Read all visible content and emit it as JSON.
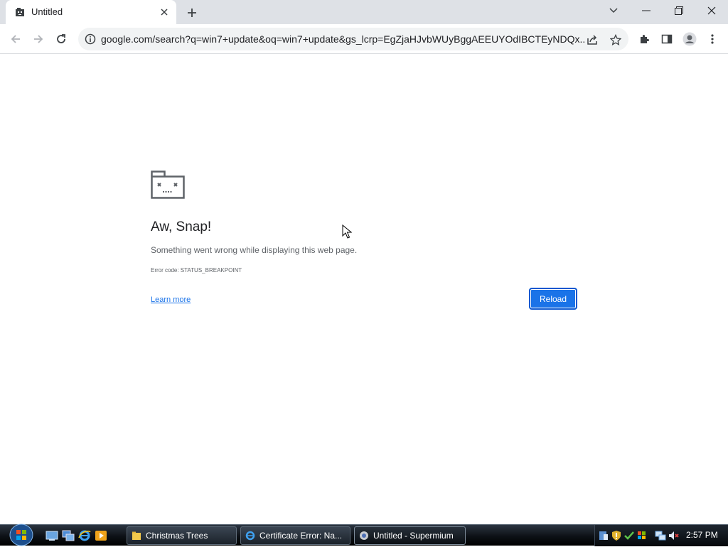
{
  "tab": {
    "title": "Untitled",
    "favicon": "sad-tab-icon"
  },
  "toolbar": {
    "url": "google.com/search?q=win7+update&oq=win7+update&gs_lcrp=EgZjaHJvbWUyBggAEEUYOdIBCTEyNDQx..."
  },
  "error_page": {
    "title": "Aw, Snap!",
    "message": "Something went wrong while displaying this web page.",
    "error_code": "Error code: STATUS_BREAKPOINT",
    "learn_more": "Learn more",
    "reload": "Reload"
  },
  "taskbar": {
    "tasks": [
      {
        "label": "Christmas Trees",
        "icon": "folder-icon"
      },
      {
        "label": "Certificate Error: Na...",
        "icon": "ie-icon"
      },
      {
        "label": "Untitled - Supermium",
        "icon": "supermium-icon",
        "active": true
      }
    ],
    "clock": "2:57 PM"
  },
  "colors": {
    "accent": "#1a73e8",
    "tabstrip": "#dee1e6"
  }
}
